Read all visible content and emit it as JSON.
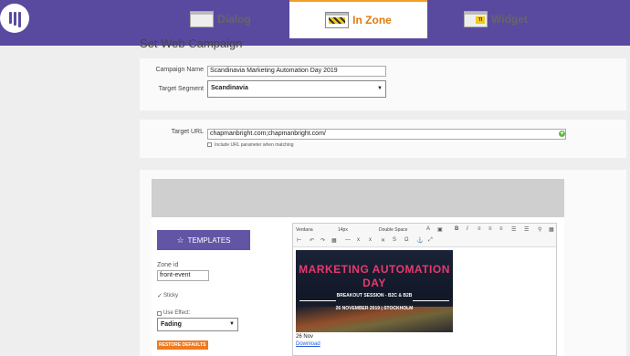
{
  "header": {
    "logo_icon": "marketo-logo-icon",
    "brand_color": "#5a4a9f"
  },
  "page_title": "Set Web Campaign",
  "campaign": {
    "name_label": "Campaign Name",
    "name_value": "Scandinavia Marketing Automation Day 2019",
    "segment_label": "Target Segment",
    "segment_value": "Scandinavia"
  },
  "target": {
    "url_label": "Target URL",
    "url_value": "chapmanbright.com;chapmanbright.com/",
    "include_param_label": "Include URL parameter when matching"
  },
  "tabs": [
    {
      "label": "Dialog",
      "icon": "dialog-icon"
    },
    {
      "label": "In Zone",
      "icon": "in-zone-icon",
      "active": true
    },
    {
      "label": "Widget",
      "icon": "widget-icon"
    }
  ],
  "left_panel": {
    "templates_label": "TEMPLATES",
    "zone_id_label": "Zone id",
    "zone_id_value": "front-event",
    "sticky_label": "Sticky",
    "use_effect_label": "Use Effect:",
    "effect_value": "Fading",
    "restore_label": "RESTORE DEFAULTS"
  },
  "editor": {
    "font_family": "Verdana",
    "font_size": "14px",
    "line_spacing": "Double Space",
    "banner": {
      "title_line1": "MARKETING AUTOMATION",
      "title_line2": "DAY",
      "subtitle": "BREAKOUT SESSION - B2C & B2B",
      "date_line": "26 NOVEMBER 2019 | STOCKHOLM"
    },
    "date_text": "26 Nov",
    "link_text": "Download"
  },
  "colors": {
    "accent_orange": "#f07a1e",
    "tab_active": "#e07a10",
    "button_purple": "#6255a6",
    "banner_pink": "#e63a6e"
  }
}
